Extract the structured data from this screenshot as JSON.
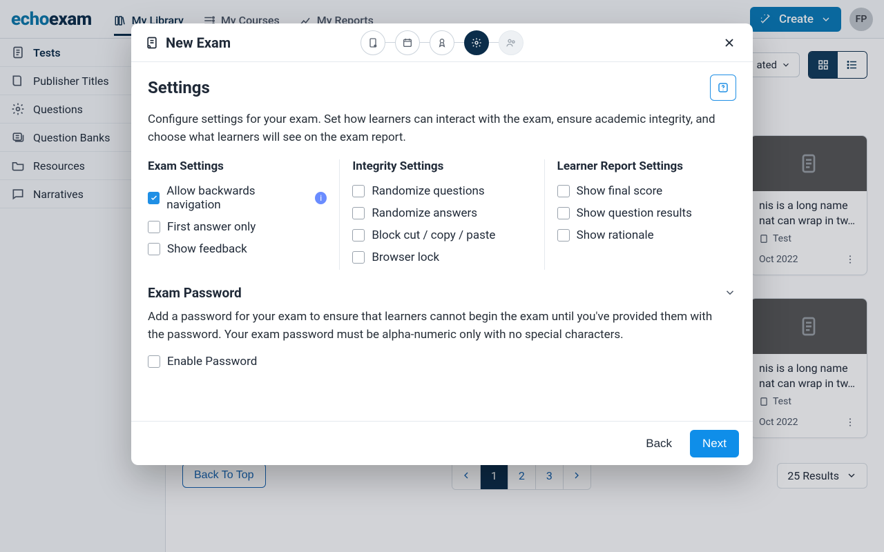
{
  "brand": {
    "part1": "echo",
    "part2": "exam"
  },
  "topnav": {
    "tabs": [
      {
        "label": "My Library",
        "icon": "library-icon"
      },
      {
        "label": "My Courses",
        "icon": "courses-icon"
      },
      {
        "label": "My Reports",
        "icon": "reports-icon"
      }
    ],
    "create_label": "Create",
    "avatar_initials": "FP"
  },
  "sidebar": {
    "items": [
      {
        "label": "Tests"
      },
      {
        "label": "Publisher Titles"
      },
      {
        "label": "Questions"
      },
      {
        "label": "Question Banks"
      },
      {
        "label": "Resources"
      },
      {
        "label": "Narratives"
      }
    ]
  },
  "toolbar": {
    "sort_label": "ated"
  },
  "cards": [
    {
      "title": "nis is a long name nat can wrap in tw…",
      "type": "Test",
      "date": "Oct 2022"
    },
    {
      "title": "nis is a long name nat can wrap in tw…",
      "type": "Test",
      "date": "Oct 2022"
    }
  ],
  "bottom": {
    "back_to_top": "Back To Top",
    "pages": [
      "1",
      "2",
      "3"
    ],
    "results": "25 Results"
  },
  "modal": {
    "title": "New Exam",
    "section_title": "Settings",
    "section_desc": "Configure settings for your exam. Set how learners can interact with the exam, ensure academic integrity, and choose what learners will see on the exam report.",
    "col1_title": "Exam Settings",
    "col1_items": [
      {
        "label": "Allow backwards navigation",
        "checked": true,
        "info": true
      },
      {
        "label": "First answer only",
        "checked": false
      },
      {
        "label": "Show feedback",
        "checked": false
      }
    ],
    "col2_title": "Integrity Settings",
    "col2_items": [
      {
        "label": "Randomize questions",
        "checked": false
      },
      {
        "label": "Randomize answers",
        "checked": false
      },
      {
        "label": "Block cut / copy / paste",
        "checked": false
      },
      {
        "label": "Browser lock",
        "checked": false
      }
    ],
    "col3_title": "Learner Report Settings",
    "col3_items": [
      {
        "label": "Show final score",
        "checked": false
      },
      {
        "label": "Show question results",
        "checked": false
      },
      {
        "label": "Show rationale",
        "checked": false
      }
    ],
    "pw_title": "Exam Password",
    "pw_desc": "Add a password for your exam to ensure that learners cannot begin the exam until you've provided them with the password. Your exam password must be alpha-numeric only with no special characters.",
    "pw_enable": "Enable Password",
    "back": "Back",
    "next": "Next"
  }
}
